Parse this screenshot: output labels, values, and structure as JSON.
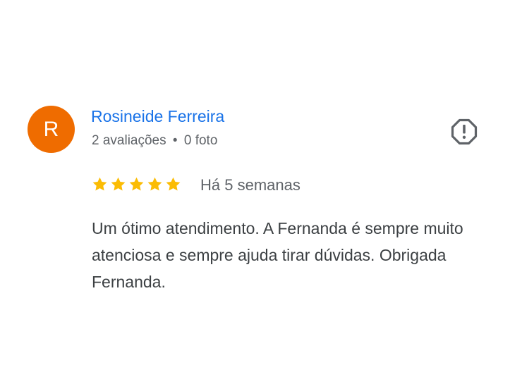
{
  "reviewer": {
    "initial": "R",
    "name": "Rosineide Ferreira",
    "reviews_count": "2 avaliações",
    "separator": "•",
    "photos_count": "0 foto",
    "avatar_color": "#EF6C00"
  },
  "review": {
    "rating": 5,
    "rating_max": 5,
    "time": "Há 5 semanas",
    "text": "Um ótimo atendimento. A Fernanda é sempre muito atenciosa e sempre ajuda tirar dúvidas. Obrigada Fernanda.",
    "star_color": "#FBBC04"
  },
  "actions": {
    "report_icon": "report-icon"
  },
  "colors": {
    "name_link": "#1A73E8",
    "secondary_text": "#5F6368",
    "body_text": "#3C4043",
    "icon": "#5F6368"
  }
}
